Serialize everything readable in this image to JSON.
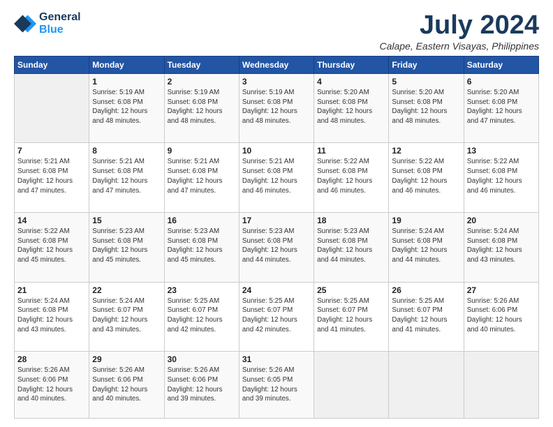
{
  "logo": {
    "line1": "General",
    "line2": "Blue"
  },
  "title": "July 2024",
  "location": "Calape, Eastern Visayas, Philippines",
  "header_days": [
    "Sunday",
    "Monday",
    "Tuesday",
    "Wednesday",
    "Thursday",
    "Friday",
    "Saturday"
  ],
  "weeks": [
    [
      {
        "num": "",
        "info": ""
      },
      {
        "num": "1",
        "info": "Sunrise: 5:19 AM\nSunset: 6:08 PM\nDaylight: 12 hours\nand 48 minutes."
      },
      {
        "num": "2",
        "info": "Sunrise: 5:19 AM\nSunset: 6:08 PM\nDaylight: 12 hours\nand 48 minutes."
      },
      {
        "num": "3",
        "info": "Sunrise: 5:19 AM\nSunset: 6:08 PM\nDaylight: 12 hours\nand 48 minutes."
      },
      {
        "num": "4",
        "info": "Sunrise: 5:20 AM\nSunset: 6:08 PM\nDaylight: 12 hours\nand 48 minutes."
      },
      {
        "num": "5",
        "info": "Sunrise: 5:20 AM\nSunset: 6:08 PM\nDaylight: 12 hours\nand 48 minutes."
      },
      {
        "num": "6",
        "info": "Sunrise: 5:20 AM\nSunset: 6:08 PM\nDaylight: 12 hours\nand 47 minutes."
      }
    ],
    [
      {
        "num": "7",
        "info": "Sunrise: 5:21 AM\nSunset: 6:08 PM\nDaylight: 12 hours\nand 47 minutes."
      },
      {
        "num": "8",
        "info": "Sunrise: 5:21 AM\nSunset: 6:08 PM\nDaylight: 12 hours\nand 47 minutes."
      },
      {
        "num": "9",
        "info": "Sunrise: 5:21 AM\nSunset: 6:08 PM\nDaylight: 12 hours\nand 47 minutes."
      },
      {
        "num": "10",
        "info": "Sunrise: 5:21 AM\nSunset: 6:08 PM\nDaylight: 12 hours\nand 46 minutes."
      },
      {
        "num": "11",
        "info": "Sunrise: 5:22 AM\nSunset: 6:08 PM\nDaylight: 12 hours\nand 46 minutes."
      },
      {
        "num": "12",
        "info": "Sunrise: 5:22 AM\nSunset: 6:08 PM\nDaylight: 12 hours\nand 46 minutes."
      },
      {
        "num": "13",
        "info": "Sunrise: 5:22 AM\nSunset: 6:08 PM\nDaylight: 12 hours\nand 46 minutes."
      }
    ],
    [
      {
        "num": "14",
        "info": "Sunrise: 5:22 AM\nSunset: 6:08 PM\nDaylight: 12 hours\nand 45 minutes."
      },
      {
        "num": "15",
        "info": "Sunrise: 5:23 AM\nSunset: 6:08 PM\nDaylight: 12 hours\nand 45 minutes."
      },
      {
        "num": "16",
        "info": "Sunrise: 5:23 AM\nSunset: 6:08 PM\nDaylight: 12 hours\nand 45 minutes."
      },
      {
        "num": "17",
        "info": "Sunrise: 5:23 AM\nSunset: 6:08 PM\nDaylight: 12 hours\nand 44 minutes."
      },
      {
        "num": "18",
        "info": "Sunrise: 5:23 AM\nSunset: 6:08 PM\nDaylight: 12 hours\nand 44 minutes."
      },
      {
        "num": "19",
        "info": "Sunrise: 5:24 AM\nSunset: 6:08 PM\nDaylight: 12 hours\nand 44 minutes."
      },
      {
        "num": "20",
        "info": "Sunrise: 5:24 AM\nSunset: 6:08 PM\nDaylight: 12 hours\nand 43 minutes."
      }
    ],
    [
      {
        "num": "21",
        "info": "Sunrise: 5:24 AM\nSunset: 6:08 PM\nDaylight: 12 hours\nand 43 minutes."
      },
      {
        "num": "22",
        "info": "Sunrise: 5:24 AM\nSunset: 6:07 PM\nDaylight: 12 hours\nand 43 minutes."
      },
      {
        "num": "23",
        "info": "Sunrise: 5:25 AM\nSunset: 6:07 PM\nDaylight: 12 hours\nand 42 minutes."
      },
      {
        "num": "24",
        "info": "Sunrise: 5:25 AM\nSunset: 6:07 PM\nDaylight: 12 hours\nand 42 minutes."
      },
      {
        "num": "25",
        "info": "Sunrise: 5:25 AM\nSunset: 6:07 PM\nDaylight: 12 hours\nand 41 minutes."
      },
      {
        "num": "26",
        "info": "Sunrise: 5:25 AM\nSunset: 6:07 PM\nDaylight: 12 hours\nand 41 minutes."
      },
      {
        "num": "27",
        "info": "Sunrise: 5:26 AM\nSunset: 6:06 PM\nDaylight: 12 hours\nand 40 minutes."
      }
    ],
    [
      {
        "num": "28",
        "info": "Sunrise: 5:26 AM\nSunset: 6:06 PM\nDaylight: 12 hours\nand 40 minutes."
      },
      {
        "num": "29",
        "info": "Sunrise: 5:26 AM\nSunset: 6:06 PM\nDaylight: 12 hours\nand 40 minutes."
      },
      {
        "num": "30",
        "info": "Sunrise: 5:26 AM\nSunset: 6:06 PM\nDaylight: 12 hours\nand 39 minutes."
      },
      {
        "num": "31",
        "info": "Sunrise: 5:26 AM\nSunset: 6:05 PM\nDaylight: 12 hours\nand 39 minutes."
      },
      {
        "num": "",
        "info": ""
      },
      {
        "num": "",
        "info": ""
      },
      {
        "num": "",
        "info": ""
      }
    ]
  ]
}
